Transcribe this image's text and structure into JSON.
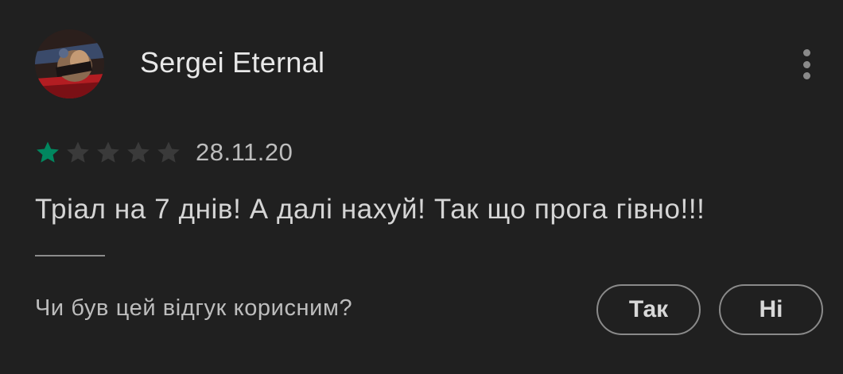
{
  "review": {
    "author_name": "Sergei Eternal",
    "rating": 1,
    "max_rating": 5,
    "date": "28.11.20",
    "text": "Тріал на 7 днів! А далі нахуй! Так що прога гівно!!!",
    "menu_icon": "more-vert-icon"
  },
  "helpful": {
    "question": "Чи був цей відгук корисним?",
    "yes_label": "Так",
    "no_label": "Ні"
  },
  "colors": {
    "background": "#202020",
    "star_filled": "#01875f",
    "star_empty": "#3a3a3a",
    "text_primary": "#e8e8e8",
    "text_secondary": "#bdbdbd"
  }
}
